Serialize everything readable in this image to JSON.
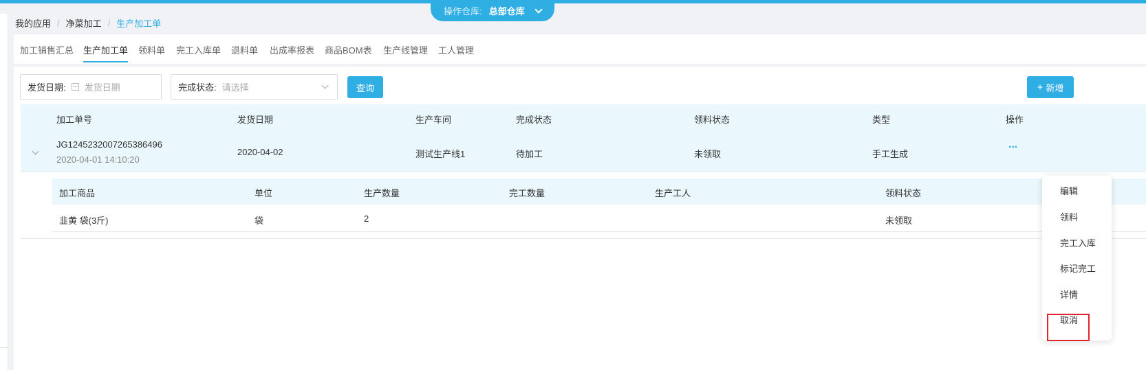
{
  "warehouse": {
    "label": "操作仓库:",
    "value": "总部仓库"
  },
  "breadcrumb": {
    "items": [
      "我的应用",
      "净菜加工",
      "生产加工单"
    ],
    "separator": "/"
  },
  "tabs": [
    {
      "label": "加工销售汇总",
      "active": false
    },
    {
      "label": "生产加工单",
      "active": true
    },
    {
      "label": "领料单",
      "active": false
    },
    {
      "label": "完工入库单",
      "active": false
    },
    {
      "label": "退料单",
      "active": false
    },
    {
      "label": "出成率报表",
      "active": false
    },
    {
      "label": "商品BOM表",
      "active": false
    },
    {
      "label": "生产线管理",
      "active": false
    },
    {
      "label": "工人管理",
      "active": false
    }
  ],
  "filters": {
    "ship_date": {
      "label": "发货日期:",
      "placeholder": "发货日期"
    },
    "status": {
      "label": "完成状态:",
      "placeholder": "请选择"
    },
    "query_button": "查询",
    "add_button": "新增"
  },
  "table": {
    "headers": [
      "加工单号",
      "发货日期",
      "生产车间",
      "完成状态",
      "领料状态",
      "类型",
      "操作"
    ],
    "row": {
      "order_no": "JG1245232007265386496",
      "created_at": "2020-04-01 14:10:20",
      "ship_date": "2020-04-02",
      "workshop": "测试生产线1",
      "status": "待加工",
      "material_status": "未领取",
      "type": "手工生成",
      "more": "···"
    }
  },
  "subtable": {
    "headers": [
      "加工商品",
      "单位",
      "生产数量",
      "完工数量",
      "生产工人",
      "领料状态"
    ],
    "row": {
      "product": "韭黄 袋(3斤)",
      "unit": "袋",
      "qty": "2",
      "done_qty": "",
      "worker": "",
      "material_status": "未领取"
    }
  },
  "action_menu": [
    "编辑",
    "领料",
    "完工入库",
    "标记完工",
    "详情",
    "取消"
  ],
  "colors": {
    "accent": "#2eaee3",
    "highlight": "#e0262f",
    "row_bg": "#eaf7fc"
  }
}
